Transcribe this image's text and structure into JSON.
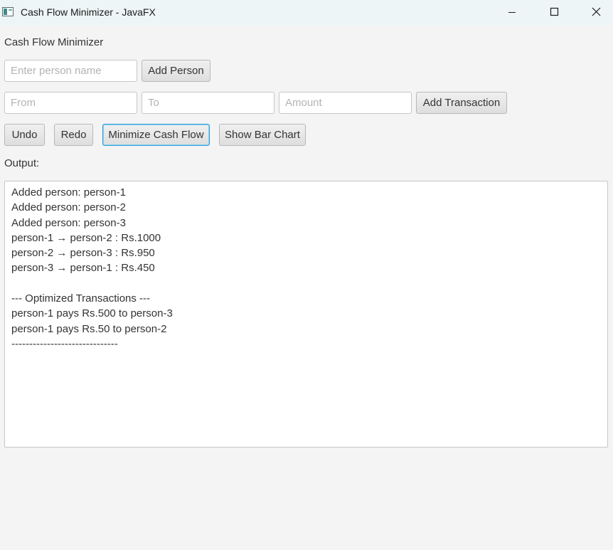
{
  "window": {
    "title": "Cash Flow Minimizer - JavaFX",
    "controls": [
      "minimize-icon",
      "maximize-icon",
      "close-icon"
    ]
  },
  "app": {
    "heading": "Cash Flow Minimizer"
  },
  "person_row": {
    "name_placeholder": "Enter person name",
    "name_value": "",
    "add_person_label": "Add Person"
  },
  "transaction_row": {
    "from_placeholder": "From",
    "to_placeholder": "To",
    "amount_placeholder": "Amount",
    "add_transaction_label": "Add Transaction"
  },
  "actions": {
    "undo_label": "Undo",
    "redo_label": "Redo",
    "minimize_label": "Minimize Cash Flow",
    "bar_chart_label": "Show Bar Chart"
  },
  "output": {
    "label": "Output:",
    "lines": [
      "Added person: person-1",
      "Added person: person-2",
      "Added person: person-3",
      "person-1 → person-2 : Rs.1000",
      "person-2 → person-3 : Rs.950",
      "person-3 → person-1 : Rs.450",
      "",
      "--- Optimized Transactions ---",
      "person-1 pays Rs.500 to person-3",
      "person-1 pays Rs.50 to person-2",
      "------------------------------"
    ]
  },
  "colors": {
    "focus_accent": "#2a9fd8",
    "titlebar_bg": "#eef5f6",
    "window_bg": "#f4f4f4"
  }
}
